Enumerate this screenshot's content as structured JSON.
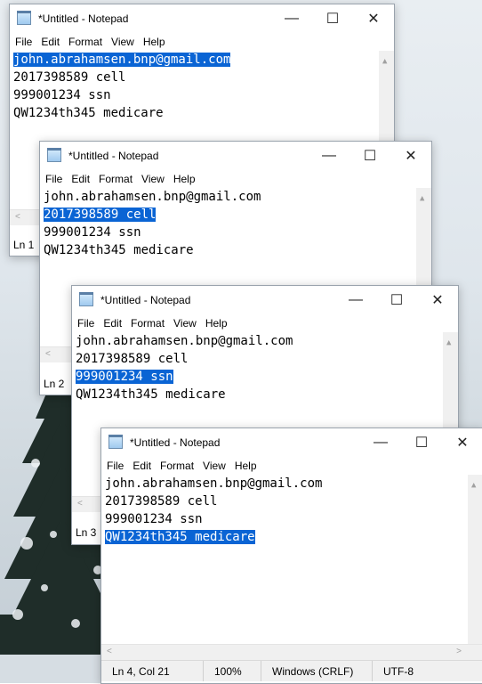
{
  "windows": [
    {
      "title": "*Untitled - Notepad",
      "menu": [
        "File",
        "Edit",
        "Format",
        "View",
        "Help"
      ],
      "lines": [
        "john.abrahamsen.bnp@gmail.com",
        "2017398589 cell",
        "999001234 ssn",
        "QW1234th345 medicare"
      ],
      "selected_line": 0,
      "status_partial": "Ln 1"
    },
    {
      "title": "*Untitled - Notepad",
      "menu": [
        "File",
        "Edit",
        "Format",
        "View",
        "Help"
      ],
      "lines": [
        "john.abrahamsen.bnp@gmail.com",
        "2017398589 cell",
        "999001234 ssn",
        "QW1234th345 medicare"
      ],
      "selected_line": 1,
      "status_partial": "Ln 2"
    },
    {
      "title": "*Untitled - Notepad",
      "menu": [
        "File",
        "Edit",
        "Format",
        "View",
        "Help"
      ],
      "lines": [
        "john.abrahamsen.bnp@gmail.com",
        "2017398589 cell",
        "999001234 ssn",
        "QW1234th345 medicare"
      ],
      "selected_line": 2,
      "status_partial": "Ln 3"
    },
    {
      "title": "*Untitled - Notepad",
      "menu": [
        "File",
        "Edit",
        "Format",
        "View",
        "Help"
      ],
      "lines": [
        "john.abrahamsen.bnp@gmail.com",
        "2017398589 cell",
        "999001234 ssn",
        "QW1234th345 medicare"
      ],
      "selected_line": 3,
      "status": {
        "position": "Ln 4, Col 21",
        "zoom": "100%",
        "line_ending": "Windows (CRLF)",
        "encoding": "UTF-8"
      }
    }
  ],
  "controls": {
    "minimize": "—",
    "maximize": "☐",
    "close": "✕"
  },
  "colors": {
    "selection": "#0a64d4",
    "desktop_snow": "#dfe6ec",
    "tree": "#1d2a26"
  }
}
